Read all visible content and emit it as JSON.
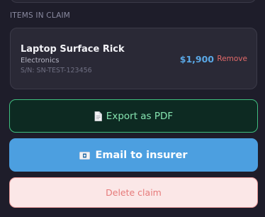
{
  "section": {
    "items_label": "ITEMS IN CLAIM"
  },
  "item": {
    "name": "Laptop Surface Rick",
    "category": "Electronics",
    "serial": "S/N: SN-TEST-123456",
    "price": "$1,900",
    "remove_label": "Remove"
  },
  "actions": {
    "export_pdf_label": "Export as PDF",
    "export_pdf_icon": "document-icon",
    "email_label": "Email to insurer",
    "email_icon": "email-icon",
    "delete_label": "Delete claim"
  },
  "colors": {
    "background": "#1e1d2a",
    "accent_blue": "#4c9fe0",
    "success_green": "#3fbe7f",
    "danger_red": "#e46a6a"
  }
}
